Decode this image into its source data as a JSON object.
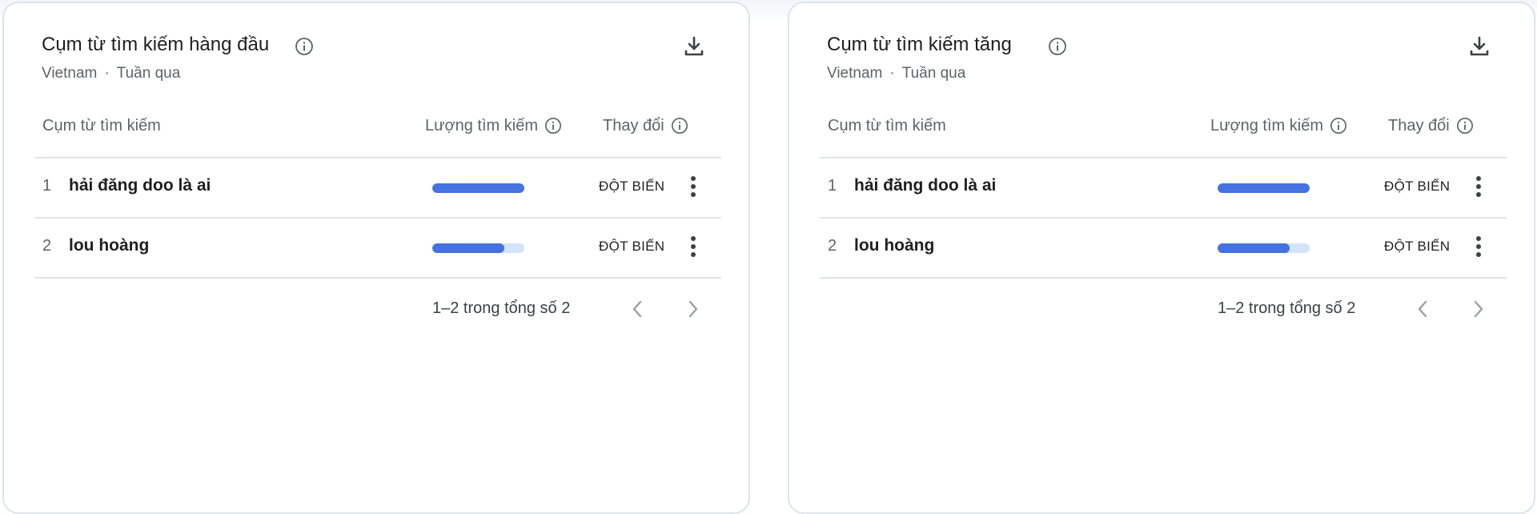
{
  "cards": [
    {
      "title": "Cụm từ tìm kiếm hàng đầu",
      "location": "Vietnam",
      "separator": "·",
      "period": "Tuần qua",
      "columns": {
        "term": "Cụm từ tìm kiếm",
        "volume": "Lượng tìm kiếm",
        "change": "Thay đổi"
      },
      "rows": [
        {
          "rank": "1",
          "term": "hải đăng doo là ai",
          "volume_fraction": 1.0,
          "change": "ĐỘT BIẾN"
        },
        {
          "rank": "2",
          "term": "lou hoàng",
          "volume_fraction": 0.78,
          "change": "ĐỘT BIẾN"
        }
      ],
      "pagination": "1–2 trong tổng số 2"
    },
    {
      "title": "Cụm từ tìm kiếm tăng",
      "location": "Vietnam",
      "separator": "·",
      "period": "Tuần qua",
      "columns": {
        "term": "Cụm từ tìm kiếm",
        "volume": "Lượng tìm kiếm",
        "change": "Thay đổi"
      },
      "rows": [
        {
          "rank": "1",
          "term": "hải đăng doo là ai",
          "volume_fraction": 1.0,
          "change": "ĐỘT BIẾN"
        },
        {
          "rank": "2",
          "term": "lou hoàng",
          "volume_fraction": 0.78,
          "change": "ĐỘT BIẾN"
        }
      ],
      "pagination": "1–2 trong tổng số 2"
    }
  ],
  "colors": {
    "bar_fill": "#4472e0",
    "bar_track": "#d2e3fc",
    "card_border": "#dde3ed"
  },
  "icons": {
    "info": "info-icon",
    "download": "download-icon",
    "more": "more-vert-icon",
    "prev": "chevron-left-icon",
    "next": "chevron-right-icon"
  }
}
